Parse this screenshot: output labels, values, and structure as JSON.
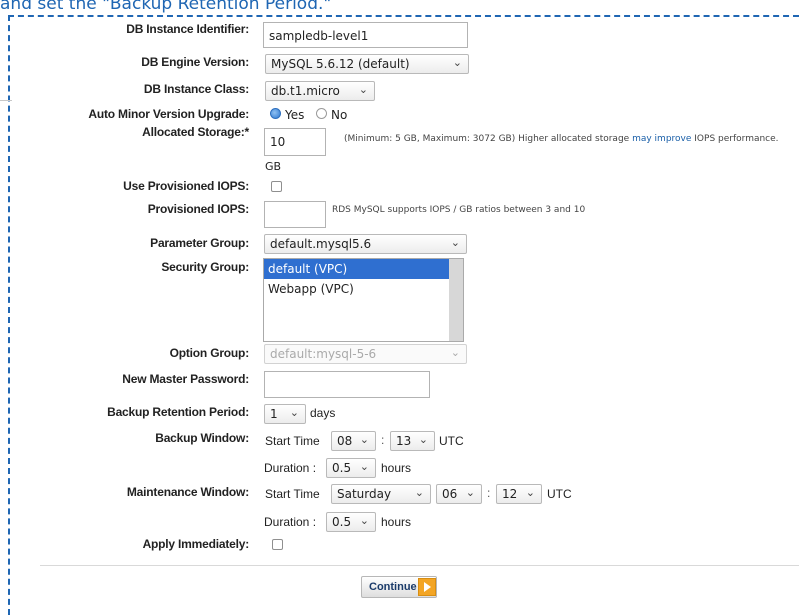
{
  "caption": "and set the \"Backup Retention Period.\"",
  "form": {
    "instance_id": {
      "label": "DB Instance Identifier:",
      "value": "sampledb-level1"
    },
    "engine_version": {
      "label": "DB Engine Version:",
      "value": "MySQL 5.6.12 (default)"
    },
    "instance_class": {
      "label": "DB Instance Class:",
      "value": "db.t1.micro"
    },
    "auto_minor": {
      "label": "Auto Minor Version Upgrade:",
      "yes": "Yes",
      "no": "No",
      "selected": "Yes"
    },
    "storage": {
      "label": "Allocated Storage:*",
      "value": "10",
      "unit": "GB",
      "note_before": "(Minimum: 5 GB, Maximum: 3072 GB) Higher allocated storage",
      "note_link": "may improve",
      "note_after": "IOPS performance."
    },
    "provisioned_iops_toggle": {
      "label": "Use Provisioned IOPS:",
      "checked": false
    },
    "provisioned_iops": {
      "label": "Provisioned IOPS:",
      "value": "",
      "note": "RDS MySQL supports IOPS / GB ratios between 3 and 10"
    },
    "parameter_group": {
      "label": "Parameter Group:",
      "value": "default.mysql5.6"
    },
    "security_group": {
      "label": "Security Group:",
      "options": [
        "default (VPC)",
        "Webapp (VPC)"
      ],
      "selected_index": 0
    },
    "option_group": {
      "label": "Option Group:",
      "value": "default:mysql-5-6"
    },
    "master_password": {
      "label": "New Master Password:",
      "value": ""
    },
    "backup_retention": {
      "label": "Backup Retention Period:",
      "value": "1",
      "unit": "days"
    },
    "backup_window": {
      "label": "Backup Window:",
      "start_label": "Start Time",
      "hour": "08",
      "minute": "13",
      "tz": "UTC",
      "duration_label": "Duration :",
      "duration": "0.5",
      "duration_unit": "hours"
    },
    "maintenance_window": {
      "label": "Maintenance Window:",
      "start_label": "Start Time",
      "day": "Saturday",
      "hour": "06",
      "minute": "12",
      "tz": "UTC",
      "duration_label": "Duration :",
      "duration": "0.5",
      "duration_unit": "hours"
    },
    "apply_immediately": {
      "label": "Apply Immediately:",
      "checked": false
    }
  },
  "continue_label": "Continue"
}
